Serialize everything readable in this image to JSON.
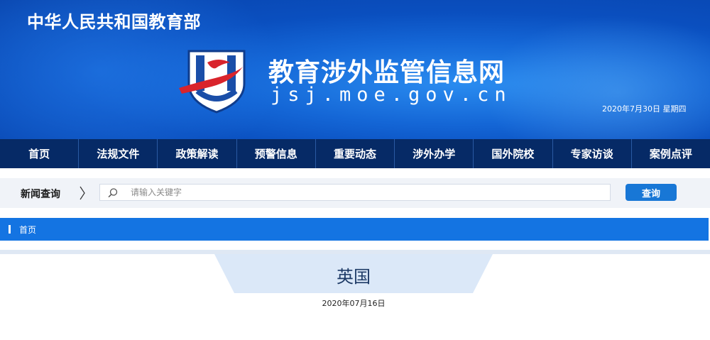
{
  "header": {
    "ministry": "中华人民共和国教育部",
    "site_name": "教育涉外监管信息网",
    "site_url": "jsj.moe.gov.cn",
    "date": "2020年7月30日  星期四",
    "logo_icon": "jsj-shield-logo"
  },
  "nav": {
    "items": [
      "首页",
      "法规文件",
      "政策解读",
      "预警信息",
      "重要动态",
      "涉外办学",
      "国外院校",
      "专家访谈",
      "案例点评"
    ]
  },
  "search": {
    "title": "新闻查询",
    "placeholder": "请输入关键字",
    "button": "查询",
    "icon": "search-icon"
  },
  "breadcrumb": {
    "home": "首页"
  },
  "article": {
    "title": "英国",
    "date": "2020年07月16日"
  },
  "colors": {
    "banner": "#0b55c8",
    "nav": "#062a66",
    "accent": "#1474e2",
    "button": "#1877d6",
    "title_tab": "#dbe8f8"
  }
}
